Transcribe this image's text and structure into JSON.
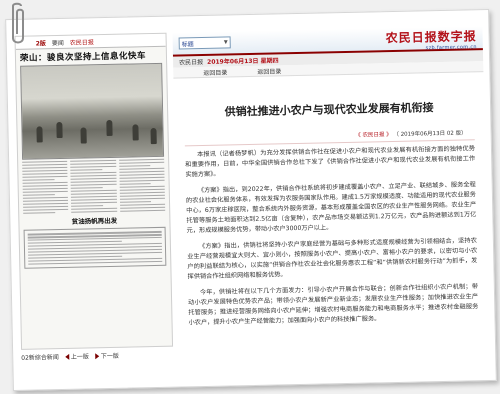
{
  "newspaper": {
    "page_label": "2版",
    "section": "要闻",
    "masthead": "农民日报",
    "headline": "荣山：骏良次坚持上信息化快车",
    "sub_headline": "贫油扬帆再出发",
    "nav_page": "02新综合新闻",
    "nav_prev": "上一版",
    "nav_next": "下一版"
  },
  "site": {
    "search_value": "标题",
    "brand_name": "农民日报数字报",
    "brand_url": "szb.farmer.com.cn",
    "issue_prefix": "农民日报",
    "issue_date": "2019年06月13日 星期四",
    "nav_left": "返回目录",
    "nav_right": "返回目录"
  },
  "article": {
    "title": "供销社推进小农户与现代农业发展有机衔接",
    "meta_source": "《 农民日报 》",
    "meta_date": "（ 2019年06月13日 02 版）",
    "paragraphs": [
      "本报讯（记者杨梦帆）为充分发挥供销合作社在促进小农户和现代农业发展有机衔接方面的独特优势和重要作用，日前，中华全国供销合作总社下发了《供销合作社促进小农户和现代农业发展有机衔接工作实施方案》。",
      "《方案》指出，到2022年，供销合作社系统将初步建成覆盖小农户、立足产业、联结城乡、服务全程的农业社会化服务体系，有效发挥为农服务国家队作用。建成1.5万家规模适度、功能适用的现代农业服务中心，6万家庄稼医院，整合系统内外服务资源，基本形成覆盖全国农区的农业生产性服务网络。农业生产托管等服务土地面积达到2.5亿亩（含复种），农产品市场交易额达到1.2万亿元，农产品购进额达到1万亿元，形成规模服务优势，带动小农户3000万户以上。",
      "《方案》指出，供销社将坚持小农户家庭经营为基础与多种形式适度规模经营为引领相结合，坚持农业生产经营规模宜大则大、宜小则小，按照服务小农户、提高小农户、富裕小农户的要求，以密切与小农户的利益联结为核心，以实施“供销合作社农业社会化服务惠农工程”和“供销新农村服务行动”为抓手，发挥供销合作社组织网络和服务优势。",
      "今年，供销社将在以下几个方面发力：引导小农户开展合作与联合；创新合作社组织小农户机制；带动小农户发展特色优势农产品；带领小农户发展新产业新业态；发展农业生产性服务；加快推进农业生产托管服务；推进经营服务网络向小农户延伸；增强农村电商服务能力和电商服务水平；推进农村金融服务小农户，提升小农户生产经营能力；加强面向小农户的科技推广服务。"
    ]
  },
  "colors": {
    "brand_red": "#b3121a",
    "nav_blue": "#2a4a9a",
    "rule_red": "#8a0000"
  }
}
